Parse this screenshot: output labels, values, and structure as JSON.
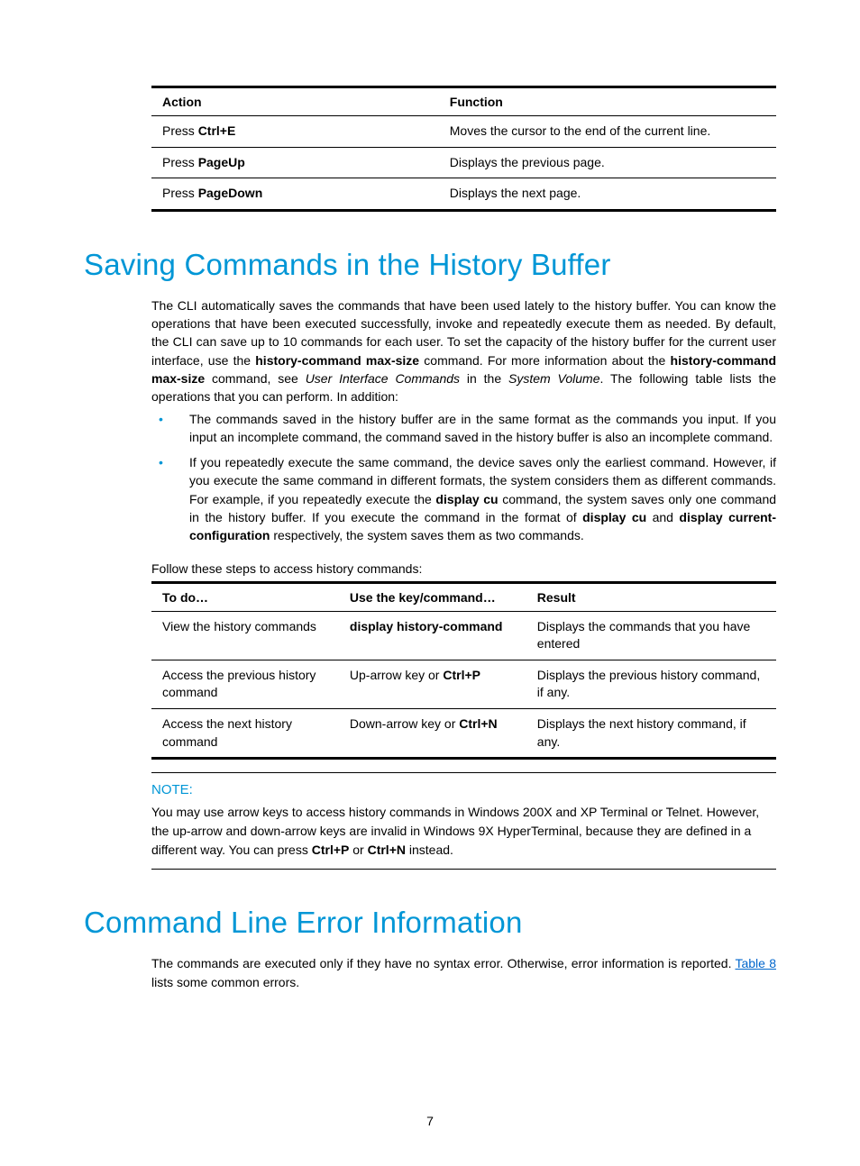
{
  "table1": {
    "headers": [
      "Action",
      "Function"
    ],
    "rows": [
      {
        "action_prefix": "Press ",
        "action_key": "Ctrl+E",
        "function": "Moves the cursor to the end of the current line."
      },
      {
        "action_prefix": "Press ",
        "action_key": "PageUp",
        "function": "Displays the previous page."
      },
      {
        "action_prefix": "Press ",
        "action_key": "PageDown",
        "function": "Displays the next page."
      }
    ]
  },
  "section1": {
    "heading": "Saving Commands in the History Buffer",
    "para_parts": {
      "p1": "The CLI automatically saves the commands that have been used lately to the history buffer. You can know the operations that have been executed successfully, invoke and repeatedly execute them as needed. By default, the CLI can save up to 10 commands for each user. To set the capacity of the history buffer for the current user interface, use the ",
      "b1": "history-command max-size",
      "p2": " command. For more information about the ",
      "b2": "history-command max-size",
      "p3": " command, see ",
      "i1": "User Interface Commands",
      "p4": " in the ",
      "i2": "System Volume",
      "p5": ". The following table lists the operations that you can perform. In addition:"
    },
    "bullets": {
      "b1": "The commands saved in the history buffer are in the same format as the commands you input. If you input an incomplete command, the command saved in the history buffer is also an incomplete command.",
      "b2_parts": {
        "t1": "If you repeatedly execute the same command, the device saves only the earliest command. However, if you execute the same command in different formats, the system considers them as different commands. For example, if you repeatedly execute the ",
        "bold1": "display cu",
        "t2": " command, the system saves only one command in the history buffer. If you execute the command in the format of ",
        "bold2": "display cu",
        "t3": " and ",
        "bold3": "display current-configuration",
        "t4": " respectively, the system saves them as two commands."
      }
    },
    "lead": "Follow these steps to access history commands:",
    "table2": {
      "headers": [
        "To do…",
        "Use the key/command…",
        "Result"
      ],
      "rows": [
        {
          "todo": "View the history commands",
          "cmd_bold": "display history-command",
          "cmd_prefix": "",
          "result": "Displays the commands that you have entered"
        },
        {
          "todo": "Access the previous history command",
          "cmd_prefix": "Up-arrow key or ",
          "cmd_bold": "Ctrl+P",
          "result": "Displays the previous history command, if any."
        },
        {
          "todo": "Access the next history command",
          "cmd_prefix": "Down-arrow key or ",
          "cmd_bold": "Ctrl+N",
          "result": "Displays the next history command, if any."
        }
      ]
    },
    "note": {
      "label": "NOTE:",
      "text_parts": {
        "t1": "You may use arrow keys to access history commands in Windows 200X and XP Terminal or Telnet. However, the up-arrow and down-arrow keys are invalid in Windows 9X HyperTerminal, because they are defined in a different way. You can press ",
        "b1": "Ctrl+P",
        "t2": " or ",
        "b2": "Ctrl+N",
        "t3": " instead."
      }
    }
  },
  "section2": {
    "heading": "Command Line Error Information",
    "para_parts": {
      "t1": "The commands are executed only if they have no syntax error. Otherwise, error information is reported. ",
      "link": "Table 8",
      "t2": " lists some common errors."
    }
  },
  "page_number": "7"
}
